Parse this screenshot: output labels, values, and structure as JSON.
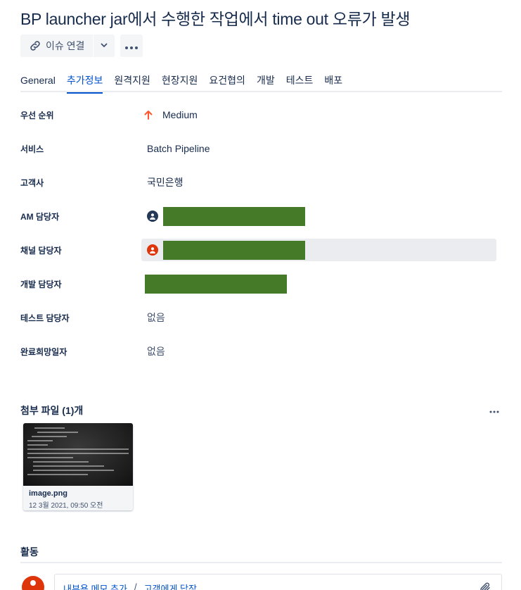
{
  "issue": {
    "title": "BP launcher jar에서 수행한 작업에서 time out 오류가 발생"
  },
  "toolbar": {
    "link_label": "이슈 연결"
  },
  "tabs": [
    {
      "label": "General"
    },
    {
      "label": "추가정보",
      "active": true
    },
    {
      "label": "원격지원"
    },
    {
      "label": "현장지원"
    },
    {
      "label": "요건협의"
    },
    {
      "label": "개발"
    },
    {
      "label": "테스트"
    },
    {
      "label": "배포"
    }
  ],
  "fields": {
    "priority": {
      "label": "우선 순위",
      "value": "Medium",
      "icon": "arrow-up-icon",
      "color": "#ff5630"
    },
    "service": {
      "label": "서비스",
      "value": "Batch Pipeline"
    },
    "customer": {
      "label": "고객사",
      "value": "국민은행"
    },
    "am_owner": {
      "label": "AM 담당자",
      "icon": "user-avatar-icon"
    },
    "channel_owner": {
      "label": "채널 담당자",
      "icon": "user-avatar-icon"
    },
    "dev_owner": {
      "label": "개발 담당자"
    },
    "test_owner": {
      "label": "테스트 담당자",
      "value": "없음"
    },
    "due": {
      "label": "완료희망일자",
      "value": "없음"
    }
  },
  "attachments": {
    "title": "첨부 파일 (1)개",
    "items": [
      {
        "name": "image.png",
        "date": "12 3월 2021, 09:50 오전"
      }
    ]
  },
  "activity": {
    "title": "활동",
    "internal_note": "내부용 메모 추가",
    "separator": "/",
    "reply": "고객에게 답장"
  },
  "colors": {
    "accent": "#0052cc",
    "redaction": "#457a29",
    "avatar_red": "#de350b"
  }
}
